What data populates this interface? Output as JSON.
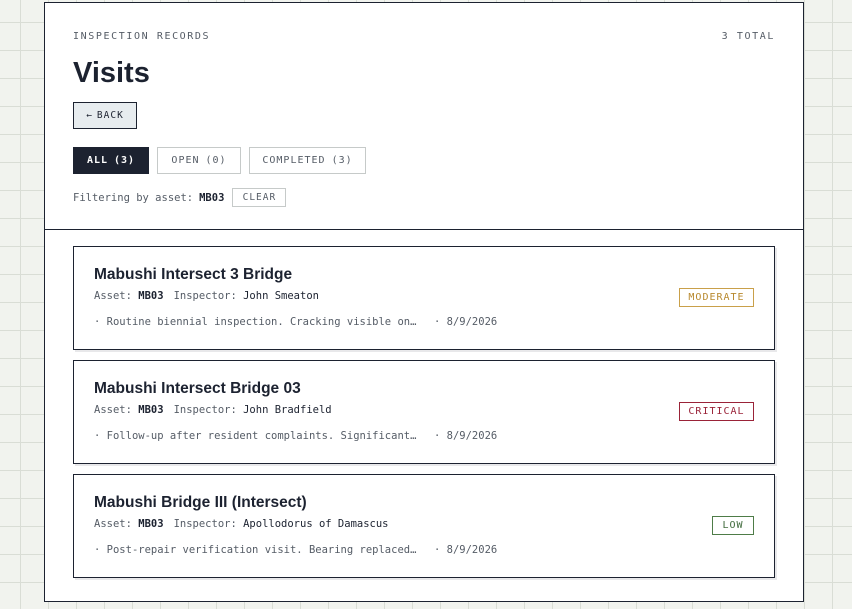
{
  "header": {
    "eyebrow": "INSPECTION RECORDS",
    "total": "3 TOTAL",
    "title": "Visits",
    "back_arrow": "←",
    "back_label": "BACK"
  },
  "tabs": [
    {
      "label": "ALL",
      "count": "(3)",
      "active": true
    },
    {
      "label": "OPEN",
      "count": "(0)",
      "active": false
    },
    {
      "label": "COMPLETED",
      "count": "(3)",
      "active": false
    }
  ],
  "filter": {
    "prefix": "Filtering by asset:",
    "asset": "MB03",
    "clear_label": "CLEAR"
  },
  "labels": {
    "asset": "Asset:",
    "inspector": "Inspector:",
    "bullet": "·"
  },
  "visits": [
    {
      "title": "Mabushi Intersect 3 Bridge",
      "asset": "MB03",
      "inspector": "John Smeaton",
      "description": "Routine biennial inspection. Cracking visible on abutment",
      "date": "· 8/9/2026",
      "severity": "MODERATE",
      "severity_color": "#b8892e"
    },
    {
      "title": "Mabushi Intersect Bridge 03",
      "asset": "MB03",
      "inspector": "John Bradfield",
      "description": "Follow-up after resident complaints. Significant deck damage",
      "date": "· 8/9/2026",
      "severity": "CRITICAL",
      "severity_color": "#9a2338"
    },
    {
      "title": "Mabushi Bridge III (Intersect)",
      "asset": "MB03",
      "inspector": "Apollodorus of Damascus",
      "description": "Post-repair verification visit. Bearing replaced and checked",
      "date": "· 8/9/2026",
      "severity": "LOW",
      "severity_color": "#3f6a3b"
    }
  ]
}
